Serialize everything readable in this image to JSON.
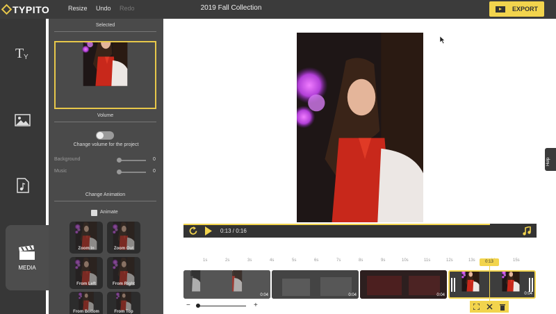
{
  "app": {
    "logo_text": "TYPITO",
    "toolbar": {
      "resize": "Resize",
      "undo": "Undo",
      "redo": "Redo"
    },
    "title": "2019 Fall Collection",
    "export_label": "EXPORT"
  },
  "rail": {
    "items": [
      {
        "icon": "text-icon",
        "label": ""
      },
      {
        "icon": "image-icon",
        "label": ""
      },
      {
        "icon": "music-file-icon",
        "label": ""
      },
      {
        "icon": "clapperboard-icon",
        "label": "MEDIA"
      }
    ]
  },
  "panel": {
    "selected_title": "Selected",
    "volume_title": "Volume",
    "volume_toggle_label": "Change volume for the project",
    "background_label": "Background",
    "background_value": "0",
    "music_label": "Music",
    "music_value": "0",
    "animation_title": "Change Animation",
    "animate_label": "Animate",
    "animations": [
      "Zoom In",
      "Zoom Out",
      "From Left",
      "From Right",
      "From Bottom",
      "From Top"
    ]
  },
  "player": {
    "current_time": "0:13",
    "separator": " / ",
    "total_time": "0:16"
  },
  "timeline": {
    "ticks": [
      "1s",
      "2s",
      "3s",
      "4s",
      "5s",
      "6s",
      "7s",
      "8s",
      "9s",
      "10s",
      "11s",
      "12s",
      "13s",
      "14s",
      "15s"
    ],
    "clips": [
      {
        "duration": "0:04"
      },
      {
        "duration": "0:04"
      },
      {
        "duration": "0:04"
      },
      {
        "duration": "0:04"
      }
    ],
    "playhead_label": "0:13",
    "zoom_minus": "−",
    "zoom_plus": "+"
  },
  "help_label": "Help",
  "colors": {
    "accent": "#f2d44d",
    "topbar": "#3b3b3b",
    "panel": "#4a4a4a",
    "rail": "#373737"
  }
}
